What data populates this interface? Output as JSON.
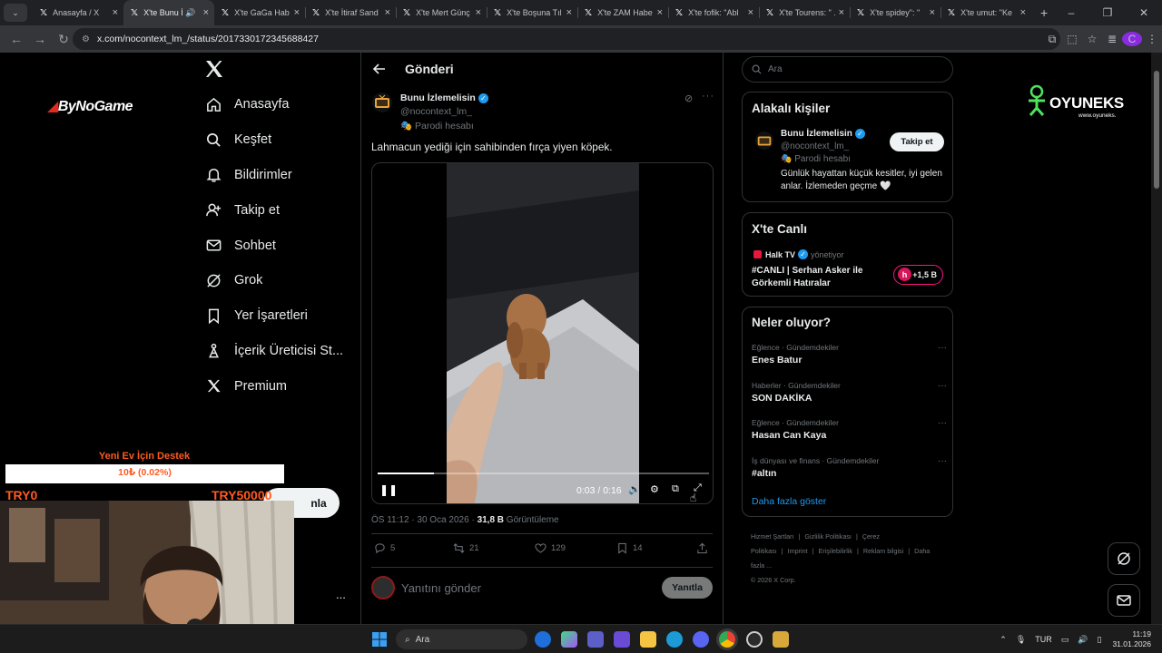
{
  "browser": {
    "tabs": [
      {
        "title": "Anasayfa / X",
        "active": false
      },
      {
        "title": "X'te Bunu İ",
        "active": true,
        "audio": true
      },
      {
        "title": "X'te GaGa Hab",
        "active": false
      },
      {
        "title": "X'te İtiraf Sand",
        "active": false
      },
      {
        "title": "X'te Mert Günç",
        "active": false
      },
      {
        "title": "X'te Boşuna Tıl",
        "active": false
      },
      {
        "title": "X'te ZAM Habe",
        "active": false
      },
      {
        "title": "X'te fofik: \"Abl",
        "active": false
      },
      {
        "title": "X'te Tourens: \" .",
        "active": false
      },
      {
        "title": "X'te spidey\": \"",
        "active": false
      },
      {
        "title": "X'te umut: \"Ke",
        "active": false
      }
    ],
    "url": "x.com/nocontext_lm_/status/2017330172345688427",
    "profile_initial": "C"
  },
  "nav": {
    "items": [
      {
        "label": "Anasayfa",
        "icon": "home-icon"
      },
      {
        "label": "Keşfet",
        "icon": "search-icon"
      },
      {
        "label": "Bildirimler",
        "icon": "bell-icon"
      },
      {
        "label": "Takip et",
        "icon": "follow-icon"
      },
      {
        "label": "Sohbet",
        "icon": "mail-icon"
      },
      {
        "label": "Grok",
        "icon": "grok-icon"
      },
      {
        "label": "Yer İşaretleri",
        "icon": "bookmark-icon"
      },
      {
        "label": "İçerik Üreticisi St...",
        "icon": "creator-studio-icon"
      },
      {
        "label": "Premium",
        "icon": "x-logo-icon"
      }
    ],
    "post_button": "nla",
    "more": "..."
  },
  "post": {
    "header_title": "Gönderi",
    "author_name": "Bunu İzlemelisin",
    "author_handle": "@nocontext_lm_",
    "author_label": "Parodi hesabı",
    "text": "Lahmacun yediği için sahibinden fırça yiyen köpek.",
    "video": {
      "time": "0:03 / 0:16",
      "progress_fraction": 0.171
    },
    "timestamp": "ÖS 11:12 · 30 Oca 2026 · ",
    "views": "31,8 B",
    "views_label": " Görüntüleme",
    "stats": {
      "replies": "5",
      "reposts": "21",
      "likes": "129",
      "bookmarks": "14"
    },
    "reply_placeholder": "Yanıtını gönder",
    "reply_button": "Yanıtla"
  },
  "sidebar": {
    "search_placeholder": "Ara",
    "related": {
      "title": "Alakalı kişiler",
      "name": "Bunu İzlemelisin",
      "handle": "@nocontext_lm_",
      "label": "Parodi hesabı",
      "bio": "Günlük hayattan küçük kesitler, iyi gelen anlar. İzlemeden geçme 🤍",
      "follow_button": "Takip et"
    },
    "live": {
      "title": "X'te Canlı",
      "source": "Halk TV",
      "source_suffix": "yönetiyor",
      "headline": "#CANLI | Serhan Asker ile Görkemli Hatıralar",
      "listeners": "+1,5 B"
    },
    "trends": {
      "title": "Neler oluyor?",
      "items": [
        {
          "category": "Eğlence · Gündemdekiler",
          "name": "Enes Batur"
        },
        {
          "category": "Haberler · Gündemdekiler",
          "name": "SON DAKİKA"
        },
        {
          "category": "Eğlence · Gündemdekiler",
          "name": "Hasan Can Kaya"
        },
        {
          "category": "İş dünyası ve finans · Gündemdekiler",
          "name": "#altın"
        }
      ],
      "show_more": "Daha fazla göster"
    },
    "footer": {
      "links": [
        "Hizmet Şartları",
        "|",
        "Gizlilik Politikası",
        "|",
        "Çerez Politikası",
        "|",
        "Imprint",
        "|",
        "Erişilebilirlik",
        "|",
        "Reklam bilgisi",
        "|",
        "Daha fazla ..."
      ],
      "copyright": "© 2026 X Corp."
    }
  },
  "overlays": {
    "bynogame_a": "By",
    "bynogame_b": "NoGame",
    "oyuneks_name": "OYUNEKS",
    "oyuneks_url": "www.oyuneks.",
    "donation": {
      "title": "Yeni Ev İçin Destek",
      "amount": "10₺ (0.02%)",
      "progress_fraction": 0.0002,
      "min": "TRY0",
      "max": "TRY50000"
    }
  },
  "taskbar": {
    "search_placeholder": "Ara",
    "language": "TUR",
    "time": "11:19",
    "date": "31.01.2026"
  },
  "colors": {
    "accent": "#1d9bf0",
    "live": "#f91880",
    "donation": "#ff5a1f",
    "brand_red": "#e12b1e"
  }
}
